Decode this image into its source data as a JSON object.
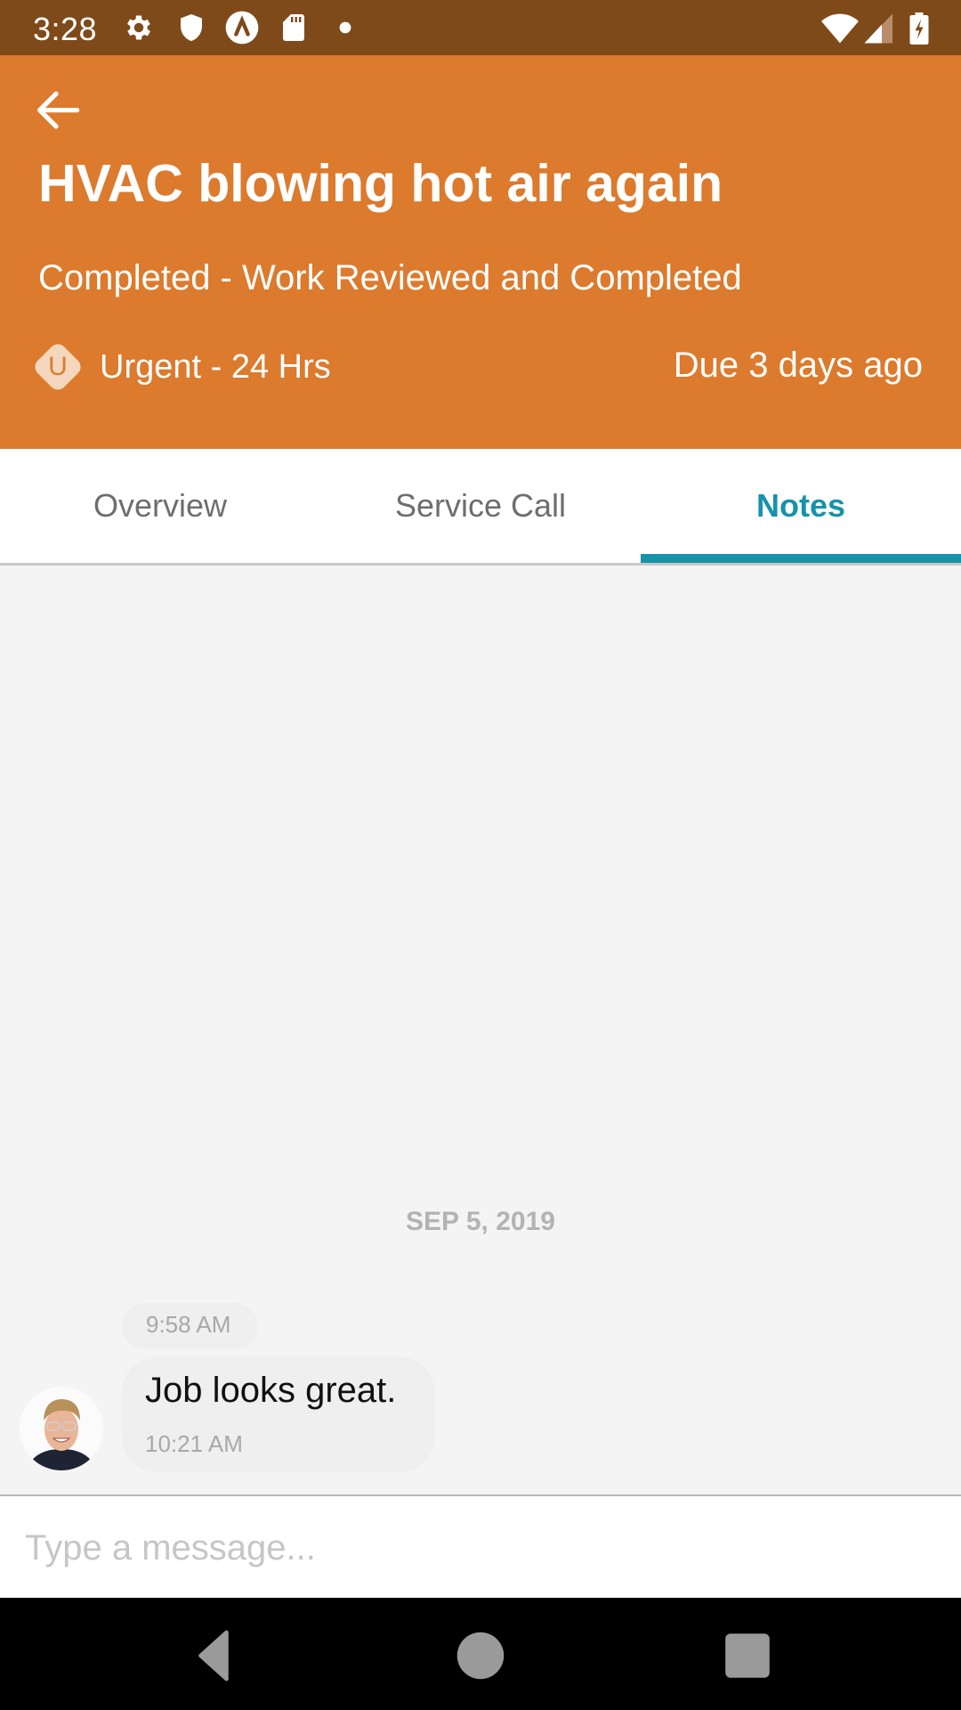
{
  "status_bar": {
    "time": "3:28",
    "left_icons": [
      "gear-icon",
      "shield-icon",
      "app-caret-icon",
      "sd-card-icon",
      "dot-icon"
    ],
    "right_icons": [
      "wifi-icon",
      "cellular-signal-icon",
      "battery-charging-icon"
    ]
  },
  "header": {
    "title": "HVAC blowing hot air again",
    "status": "Completed - Work Reviewed and Completed",
    "priority": {
      "badge_letter": "U",
      "label": "Urgent - 24 Hrs"
    },
    "due": "Due 3 days ago",
    "colors": {
      "status_bar": "#7f4a1a",
      "header_bg": "#dc7a2d",
      "accent": "#1793a9"
    }
  },
  "tabs": [
    {
      "label": "Overview",
      "active": false
    },
    {
      "label": "Service Call",
      "active": false
    },
    {
      "label": "Notes",
      "active": true
    }
  ],
  "conversation": {
    "date_separator": "SEP 5, 2019",
    "messages": [
      {
        "pill_time": "9:58 AM",
        "text": "Job looks great.",
        "time": "10:21 AM",
        "sender_avatar": "user-avatar"
      }
    ]
  },
  "composer": {
    "placeholder": "Type a message...",
    "value": ""
  },
  "nav_bar": {
    "buttons": [
      "back-nav-icon",
      "home-nav-icon",
      "recents-nav-icon"
    ]
  }
}
